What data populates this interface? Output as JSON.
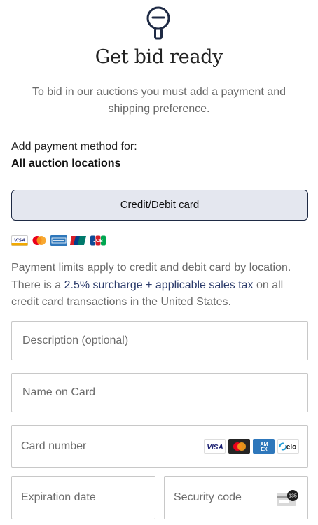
{
  "header": {
    "title": "Get bid ready",
    "subtitle": "To bid in our auctions you must add a payment and shipping preference."
  },
  "payment": {
    "add_label": "Add payment method for:",
    "location": "All auction locations",
    "method_button": "Credit/Debit card",
    "accepted_brands": [
      "VISA",
      "Mastercard",
      "AMEX",
      "UnionPay",
      "JCB"
    ]
  },
  "notice": {
    "before": "Payment limits apply to credit and debit card by location. There is a ",
    "link": "2.5% surcharge + applicable sales tax",
    "after": " on all credit card transactions in the United States."
  },
  "form": {
    "description_placeholder": "Description (optional)",
    "name_placeholder": "Name on Card",
    "card_number_placeholder": "Card number",
    "expiration_placeholder": "Expiration date",
    "security_placeholder": "Security code",
    "cvv_badge": "135",
    "card_brands": [
      "VISA",
      "Mastercard",
      "AMEX",
      "elo"
    ]
  },
  "colors": {
    "accent_navy": "#1e2a44",
    "button_bg": "#e4e7ef",
    "link": "#2a3a6a"
  }
}
